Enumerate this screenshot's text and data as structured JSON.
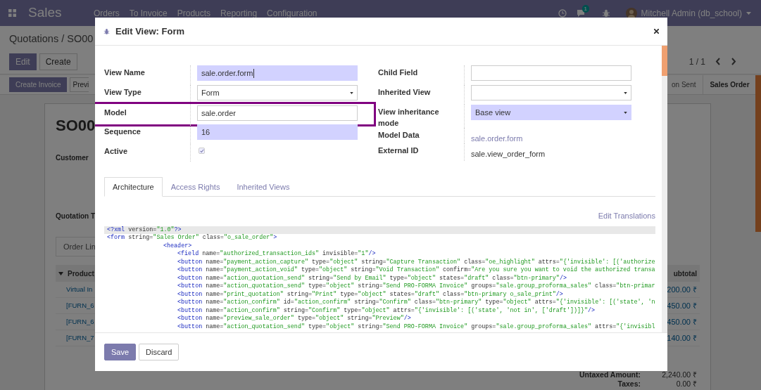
{
  "navbar": {
    "app_title": "Sales",
    "menu": [
      "Orders",
      "To Invoice",
      "Products",
      "Reporting",
      "Configuration"
    ],
    "chat_badge": "1",
    "user": "Mitchell Admin (db_school)"
  },
  "control_panel": {
    "breadcrumb": "Quotations / SO00",
    "buttons": [
      {
        "label": "Edit",
        "kind": "primary"
      },
      {
        "label": "Create",
        "kind": "secondary"
      }
    ],
    "pager": "1 / 1"
  },
  "status_bar": {
    "buttons": [
      {
        "label": "Create Invoice",
        "kind": "primary"
      },
      {
        "label": "Previ",
        "kind": "secondary"
      }
    ],
    "stages": [
      {
        "label": "on Sent",
        "selected": false
      },
      {
        "label": "Sales Order",
        "selected": true
      }
    ]
  },
  "sheet": {
    "title": "SO00",
    "labels": [
      "Customer",
      "Quotation T"
    ],
    "tab": "Order Lin",
    "table": {
      "columns": [
        "Product",
        "ubtotal"
      ],
      "rows": [
        [
          "Virtual In",
          "200.00 ₹"
        ],
        [
          "[FURN_6",
          "450.00 ₹"
        ],
        [
          "[FURN_6",
          "450.00 ₹"
        ],
        [
          "[FURN_7",
          "140.00 ₹"
        ]
      ]
    },
    "totals": [
      {
        "label": "Untaxed Amount:",
        "value": "2,240.00 ₹"
      },
      {
        "label": "Taxes:",
        "value": "0.00 ₹"
      }
    ]
  },
  "dialog": {
    "title": "Edit View: Form",
    "left_fields": [
      {
        "label": "View Name",
        "kind": "text",
        "value": "sale.order.form",
        "required": true,
        "focused": true,
        "highlighted": false
      },
      {
        "label": "View Type",
        "kind": "select",
        "value": "Form",
        "required": false,
        "highlighted": false
      },
      {
        "label": "Model",
        "kind": "text",
        "value": "sale.order",
        "required": false,
        "focused": false,
        "highlighted": true
      },
      {
        "label": "Sequence",
        "kind": "text",
        "value": "16",
        "required": true,
        "focused": false,
        "highlighted": false
      },
      {
        "label": "Active",
        "kind": "checkbox",
        "checked": true,
        "highlighted": false
      }
    ],
    "right_fields": [
      {
        "label": "Child Field",
        "kind": "text",
        "required": false,
        "focused": false
      },
      {
        "label": "Inherited View",
        "kind": "select",
        "required": false
      },
      {
        "label": "View inheritance mode",
        "kind": "select",
        "value": "Base view",
        "required": true
      },
      {
        "label": "Model Data",
        "kind": "link",
        "value": "sale.order.form"
      },
      {
        "label": "External ID",
        "kind": "static",
        "value": "sale.view_order_form"
      }
    ],
    "tabs": [
      {
        "label": "Architecture",
        "selected": true
      },
      {
        "label": "Access Rights",
        "selected": false
      },
      {
        "label": "Inherited Views",
        "selected": false
      }
    ],
    "edit_translations": "Edit Translations",
    "code_lines": [
      {
        "text": "<?xml version=\"1.0\"?>",
        "current": true
      },
      {
        "text": "<form string=\"Sales Order\" class=\"o_sale_order\">",
        "current": false,
        "children": [
          {
            "text": "<header>",
            "current": false,
            "children": [
              {
                "text": "<field name=\"authorized_transaction_ids\" invisible=\"1\"/>",
                "current": false
              },
              {
                "text": "<button name=\"payment_action_capture\" type=\"object\" string=\"Capture Transaction\" class=\"oe_highlight\" attrs=\"{'invisible': [('authorize",
                "current": false
              },
              {
                "text": "<button name=\"payment_action_void\" type=\"object\" string=\"Void Transaction\" confirm=\"Are you sure you want to void the authorized transa",
                "current": false
              },
              {
                "text": "<button name=\"action_quotation_send\" string=\"Send by Email\" type=\"object\" states=\"draft\" class=\"btn-primary\"/>",
                "current": false
              },
              {
                "text": "<button name=\"action_quotation_send\" type=\"object\" string=\"Send PRO-FORMA Invoice\" groups=\"sale.group_proforma_sales\" class=\"btn-primar",
                "current": false
              },
              {
                "text": "<button name=\"print_quotation\" string=\"Print\" type=\"object\" states=\"draft\" class=\"btn-primary o_sale_print\"/>",
                "current": false
              },
              {
                "text": "<button name=\"action_confirm\" id=\"action_confirm\" string=\"Confirm\" class=\"btn-primary\" type=\"object\" attrs=\"{'invisible': [('state', 'n",
                "current": false
              },
              {
                "text": "<button name=\"action_confirm\" string=\"Confirm\" type=\"object\" attrs=\"{'invisible': [('state', 'not in', ['draft'])]}\"/>",
                "current": false
              },
              {
                "text": "<button name=\"preview_sale_order\" type=\"object\" string=\"Preview\"/>",
                "current": false
              },
              {
                "text": "<button name=\"action_quotation_send\" type=\"object\" string=\"Send PRO-FORMA Invoice\" groups=\"sale.group_proforma_sales\" attrs=\"{'invisibl",
                "current": false
              }
            ]
          }
        ]
      }
    ],
    "footer_buttons": [
      {
        "label": "Save",
        "kind": "primary"
      },
      {
        "label": "Discard",
        "kind": "secondary"
      }
    ]
  }
}
